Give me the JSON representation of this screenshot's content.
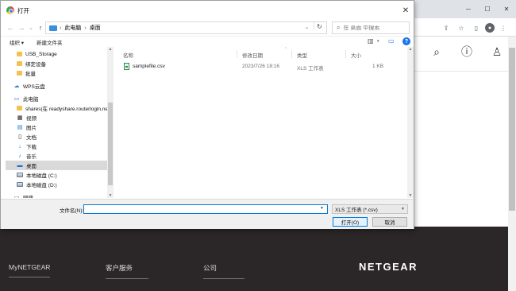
{
  "dialog": {
    "title": "打开",
    "breadcrumb": [
      "此电脑",
      "桌面"
    ],
    "search_placeholder": "在 桌面 中搜索",
    "organize": "组织 ▾",
    "new_folder": "新建文件夹",
    "nav_items": [
      {
        "label": "USB_Storage",
        "icon": "folder-icon"
      },
      {
        "label": "绑定设备",
        "icon": "folder-icon"
      },
      {
        "label": "批量",
        "icon": "folder-icon"
      },
      {
        "label": "WPS云盘",
        "icon": "cloud-icon"
      },
      {
        "label": "此电脑",
        "icon": "computer-icon"
      },
      {
        "label": "shares(在 readyshare.routerlogin.net",
        "icon": "network-folder-icon"
      },
      {
        "label": "视频",
        "icon": "video-icon"
      },
      {
        "label": "图片",
        "icon": "picture-icon"
      },
      {
        "label": "文档",
        "icon": "document-icon"
      },
      {
        "label": "下载",
        "icon": "download-icon"
      },
      {
        "label": "音乐",
        "icon": "music-icon"
      },
      {
        "label": "桌面",
        "icon": "desktop-icon",
        "selected": true
      },
      {
        "label": "本地磁盘 (C:)",
        "icon": "drive-icon"
      },
      {
        "label": "本地磁盘 (D:)",
        "icon": "drive-icon"
      },
      {
        "label": "网络",
        "icon": "network-icon"
      }
    ],
    "columns": {
      "name": "名称",
      "modified": "修改日期",
      "type": "类型",
      "size": "大小"
    },
    "files": [
      {
        "name": "samplefile.csv",
        "modified": "2023/7/26 18:16",
        "type": "XLS 工作表",
        "size": "1 KB"
      }
    ],
    "filename_label": "文件名(N):",
    "filename_value": "",
    "filetype": "XLS 工作表 (*.csv)",
    "open_button": "打开(O)",
    "cancel_button": "取消"
  },
  "page": {
    "footer_links": [
      "MyNETGEAR",
      "客户服务",
      "公司"
    ],
    "footer_logo": "NETGEAR"
  }
}
